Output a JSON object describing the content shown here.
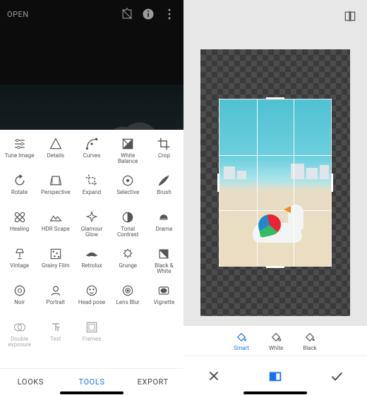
{
  "left": {
    "open_label": "OPEN",
    "tools": [
      {
        "id": "tune-image",
        "label": "Tune Image"
      },
      {
        "id": "details",
        "label": "Details"
      },
      {
        "id": "curves",
        "label": "Curves"
      },
      {
        "id": "white-balance",
        "label": "White Balance"
      },
      {
        "id": "crop",
        "label": "Crop"
      },
      {
        "id": "rotate",
        "label": "Rotate"
      },
      {
        "id": "perspective",
        "label": "Perspective"
      },
      {
        "id": "expand",
        "label": "Expand"
      },
      {
        "id": "selective",
        "label": "Selective"
      },
      {
        "id": "brush",
        "label": "Brush"
      },
      {
        "id": "healing",
        "label": "Healing"
      },
      {
        "id": "hdr-scape",
        "label": "HDR Scape"
      },
      {
        "id": "glamour-glow",
        "label": "Glamour Glow"
      },
      {
        "id": "tonal-contrast",
        "label": "Tonal Contrast"
      },
      {
        "id": "drama",
        "label": "Drama"
      },
      {
        "id": "vintage",
        "label": "Vintage"
      },
      {
        "id": "grainy-film",
        "label": "Grainy Film"
      },
      {
        "id": "retrolux",
        "label": "Retrolux"
      },
      {
        "id": "grunge",
        "label": "Grunge"
      },
      {
        "id": "black-white",
        "label": "Black & White"
      },
      {
        "id": "noir",
        "label": "Noir"
      },
      {
        "id": "portrait",
        "label": "Portrait"
      },
      {
        "id": "head-pose",
        "label": "Head pose"
      },
      {
        "id": "lens-blur",
        "label": "Lens Blur"
      },
      {
        "id": "vignette",
        "label": "Vignette"
      },
      {
        "id": "double-exposure",
        "label": "Double exposure"
      },
      {
        "id": "text",
        "label": "Text"
      },
      {
        "id": "frames",
        "label": "Frames"
      }
    ],
    "tabs": {
      "looks": "LOOKS",
      "tools": "TOOLS",
      "export": "EXPORT",
      "active": "tools"
    }
  },
  "right": {
    "fill_options": [
      {
        "id": "smart",
        "label": "Smart"
      },
      {
        "id": "white",
        "label": "White"
      },
      {
        "id": "black",
        "label": "Black"
      }
    ],
    "active_fill": "smart"
  },
  "colors": {
    "accent": "#1a73e8"
  }
}
